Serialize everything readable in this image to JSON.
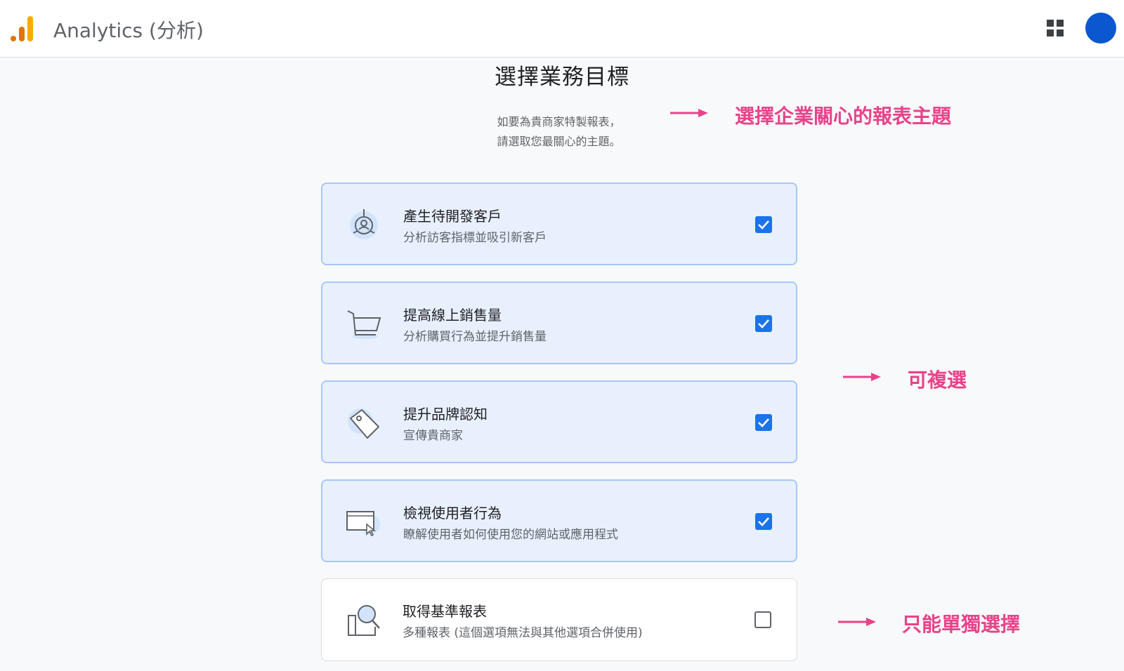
{
  "header": {
    "app_title": "Analytics (分析)",
    "logo_icon": "analytics-bar-logo",
    "apps_icon": "apps-grid-icon",
    "avatar_color": "#0b57d0"
  },
  "page": {
    "title": "選擇業務目標",
    "subtitle_line1": "如要為貴商家特製報表，",
    "subtitle_line2": "請選取您最關心的主題。"
  },
  "options": [
    {
      "title": "產生待開發客戶",
      "description": "分析訪客指標並吸引新客戶",
      "icon": "lead-target-icon",
      "checked": true
    },
    {
      "title": "提高線上銷售量",
      "description": "分析購買行為並提升銷售量",
      "icon": "shopping-cart-icon",
      "checked": true
    },
    {
      "title": "提升品牌認知",
      "description": "宣傳貴商家",
      "icon": "tag-icon",
      "checked": true
    },
    {
      "title": "檢視使用者行為",
      "description": "瞭解使用者如何使用您的網站或應用程式",
      "icon": "browser-cursor-icon",
      "checked": true
    },
    {
      "title": "取得基準報表",
      "description": "多種報表 (這個選項無法與其他選項合併使用)",
      "icon": "magnify-report-icon",
      "checked": false
    }
  ],
  "annotations": {
    "topic": "選擇企業關心的報表主題",
    "multi_select": "可複選",
    "single_select": "只能單獨選擇"
  },
  "colors": {
    "accent": "#1a73e8",
    "annotation": "#e8438a",
    "selected_card_bg": "#e8f0fe",
    "selected_card_border": "#a8c7fa"
  }
}
